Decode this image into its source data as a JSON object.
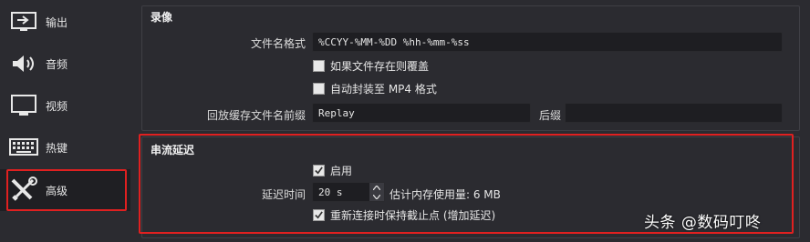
{
  "sidebar": {
    "items": [
      {
        "label": "输出",
        "icon": "output-icon"
      },
      {
        "label": "音频",
        "icon": "speaker-icon"
      },
      {
        "label": "视频",
        "icon": "monitor-icon"
      },
      {
        "label": "热键",
        "icon": "keyboard-icon"
      },
      {
        "label": "高级",
        "icon": "tools-icon"
      }
    ],
    "active_index": 4
  },
  "recording": {
    "title": "录像",
    "filename_format_label": "文件名格式",
    "filename_format_value": "%CCYY-%MM-%DD %hh-%mm-%ss",
    "overwrite_label": "如果文件存在则覆盖",
    "overwrite_checked": false,
    "remux_label": "自动封装至 MP4 格式",
    "remux_checked": false,
    "replay_prefix_label": "回放缓存文件名前缀",
    "replay_prefix_value": "Replay",
    "suffix_label": "后缀",
    "suffix_value": ""
  },
  "stream_delay": {
    "title": "串流延迟",
    "enable_label": "启用",
    "enable_checked": true,
    "delay_label": "延迟时间",
    "delay_value": "20 s",
    "memory_estimate": "估计内存使用量: 6 MB",
    "preserve_label": "重新连接时保持截止点 (增加延迟)",
    "preserve_checked": true
  },
  "colors": {
    "highlight": "#e02020",
    "panel": "#2b2b30",
    "field": "#1e1e22"
  },
  "watermark": "头条 @数码叮咚"
}
